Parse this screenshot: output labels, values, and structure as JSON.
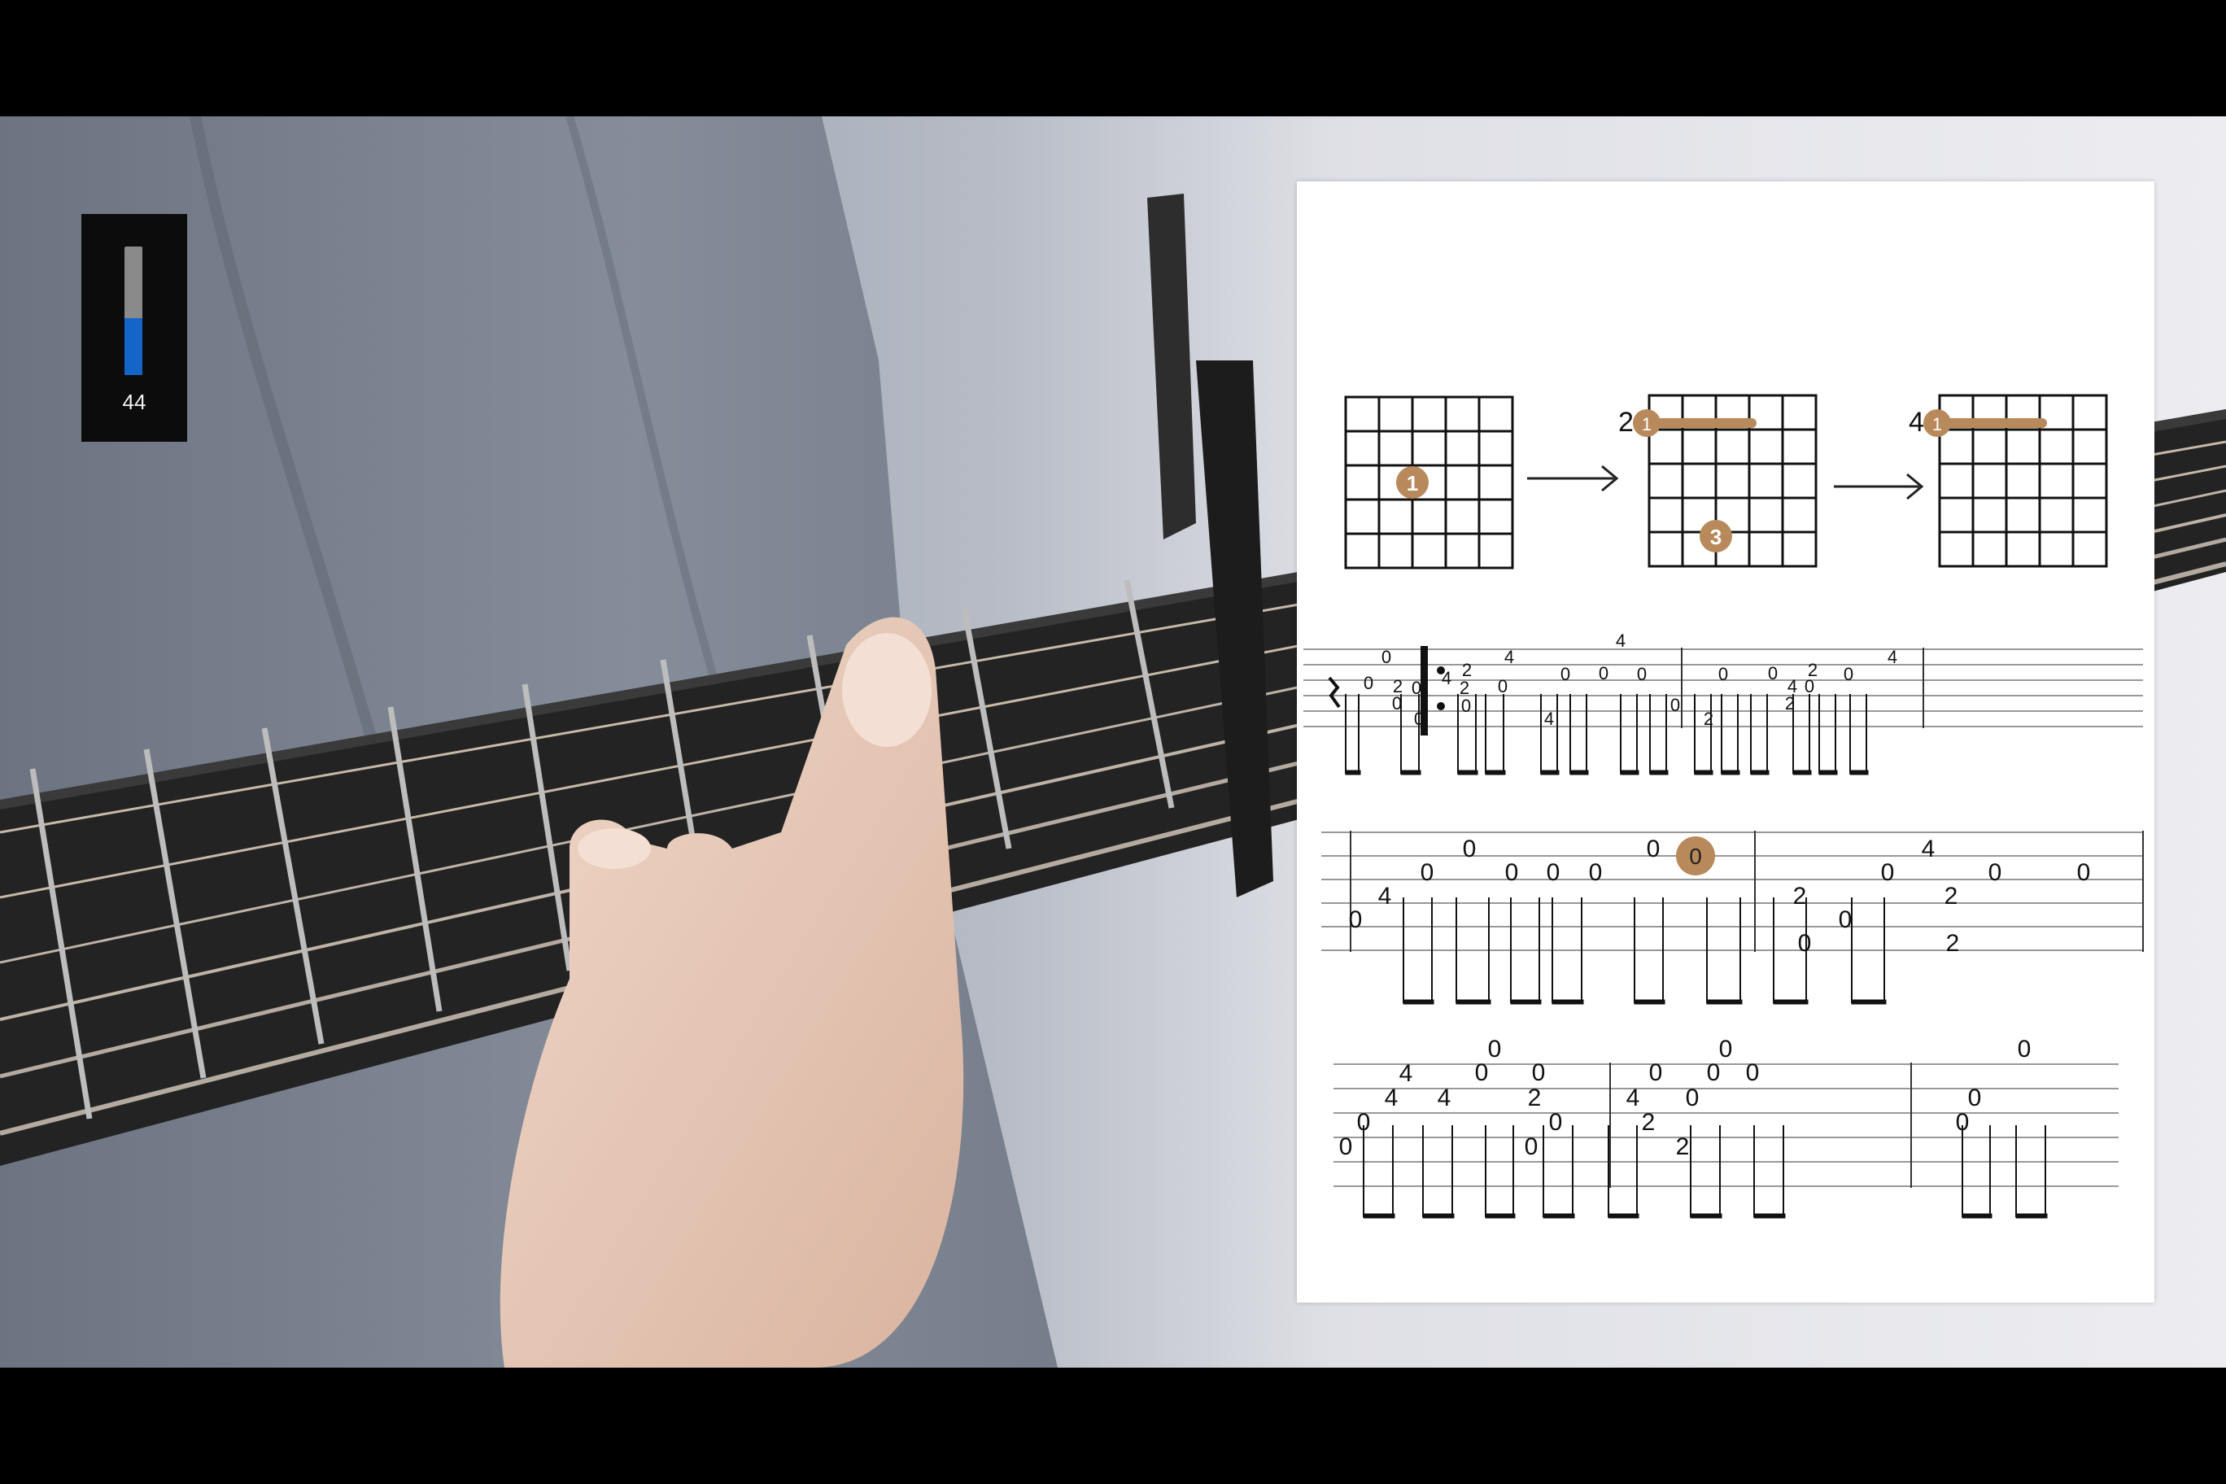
{
  "volume": {
    "value": "44",
    "level": 0.44
  },
  "sheet": {
    "chords": [
      {
        "fret_label": "",
        "finger_dots": [
          "1"
        ],
        "barre_finger": ""
      },
      {
        "fret_label": "2",
        "finger_dots": [
          "3"
        ],
        "barre_finger": "1"
      },
      {
        "fret_label": "4",
        "finger_dots": [],
        "barre_finger": "1"
      }
    ],
    "tab_numbers": {
      "row1": [
        "0",
        "0",
        "2",
        "0",
        "0",
        "0",
        "4",
        "2",
        "2",
        "0",
        "0",
        "4",
        "4",
        "0",
        "0",
        "4",
        "0",
        "0",
        "2",
        "0",
        "0",
        "4",
        "2",
        "2",
        "0",
        "0",
        "4"
      ],
      "row2": [
        "0",
        "4",
        "0",
        "0",
        "0",
        "0",
        "0",
        "0",
        "2",
        "0",
        "0",
        "0",
        "4",
        "2",
        "2",
        "0",
        "0"
      ],
      "row3": [
        "0",
        "0",
        "4",
        "4",
        "4",
        "0",
        "0",
        "2",
        "0",
        "0",
        "0",
        "4",
        "2",
        "0",
        "2",
        "0",
        "0",
        "0",
        "0",
        "0",
        "0",
        "0"
      ],
      "highlighted": "0"
    }
  },
  "colors": {
    "accent": "#b8895a",
    "volume_fill": "#1565c8"
  },
  "icons": {
    "tv_button": "tv-play-icon",
    "rest": "quarter-rest-icon"
  }
}
